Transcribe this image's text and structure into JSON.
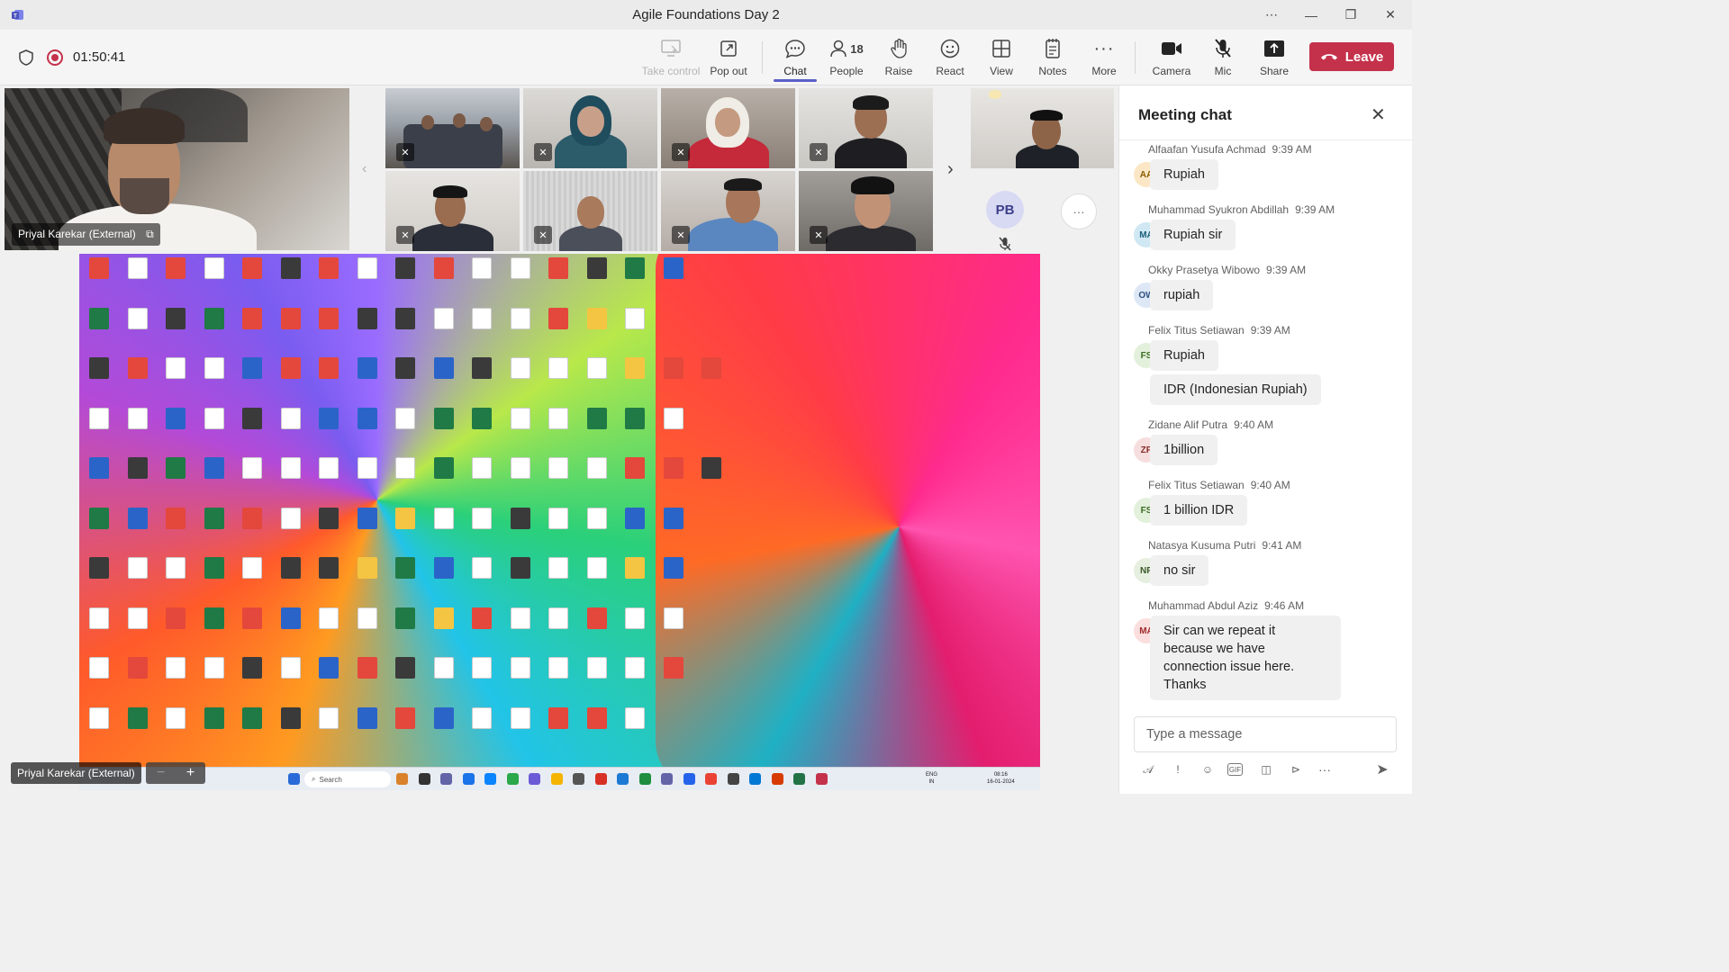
{
  "window": {
    "title": "Agile Foundations Day 2"
  },
  "toolbar": {
    "timer": "01:50:41",
    "buttons": {
      "take_control": "Take control",
      "pop_out": "Pop out",
      "chat": "Chat",
      "people": "People",
      "people_count": "18",
      "raise": "Raise",
      "react": "React",
      "view": "View",
      "notes": "Notes",
      "more": "More",
      "camera": "Camera",
      "mic": "Mic",
      "share": "Share",
      "leave": "Leave"
    },
    "accent_color": "#5b5fc7",
    "leave_color": "#c4314b"
  },
  "stage": {
    "main_speaker": "Priyal Karekar (External)",
    "share_presenter": "Priyal Karekar (External)",
    "overflow_avatar": "PB",
    "zoom_out": "−",
    "zoom_in": "+"
  },
  "desktop": {
    "taskbar_search": "Search",
    "lang": "ENG\nIN",
    "time": "08:16",
    "date": "16-01-2024"
  },
  "chat": {
    "title": "Meeting chat",
    "placeholder": "Type a message",
    "messages": [
      {
        "initials": "AA",
        "sender": "Alfaafan Yusufa Achmad",
        "time": "9:39 AM",
        "text": "Rupiah",
        "av_bg": "#fbe7c6",
        "av_fg": "#8a5a00"
      },
      {
        "initials": "MA",
        "sender": "Muhammad Syukron Abdillah",
        "time": "9:39 AM",
        "text": "Rupiah sir",
        "av_bg": "#cfe8f3",
        "av_fg": "#1b5e7a"
      },
      {
        "initials": "OW",
        "sender": "Okky Prasetya Wibowo",
        "time": "9:39 AM",
        "text": "rupiah",
        "av_bg": "#dde7f6",
        "av_fg": "#2b4f80"
      },
      {
        "initials": "FS",
        "sender": "Felix Titus Setiawan",
        "time": "9:39 AM",
        "text": "Rupiah",
        "text2": "IDR (Indonesian Rupiah)",
        "av_bg": "#e3f0dc",
        "av_fg": "#3a6b22"
      },
      {
        "initials": "ZP",
        "sender": "Zidane Alif Putra",
        "time": "9:40 AM",
        "text": "1billion",
        "av_bg": "#f6dede",
        "av_fg": "#8a2b2b"
      },
      {
        "initials": "FS",
        "sender": "Felix Titus Setiawan",
        "time": "9:40 AM",
        "text": "1 billion IDR",
        "av_bg": "#e3f0dc",
        "av_fg": "#3a6b22"
      },
      {
        "initials": "NP",
        "sender": "Natasya Kusuma Putri",
        "time": "9:41 AM",
        "text": "no sir",
        "av_bg": "#e6efe0",
        "av_fg": "#3a5a2a"
      },
      {
        "initials": "MA",
        "sender": "Muhammad Abdul Aziz",
        "time": "9:46 AM",
        "text": "Sir can we repeat it because we have connection issue here. Thanks",
        "av_bg": "#fbdede",
        "av_fg": "#a02a2a"
      }
    ]
  }
}
